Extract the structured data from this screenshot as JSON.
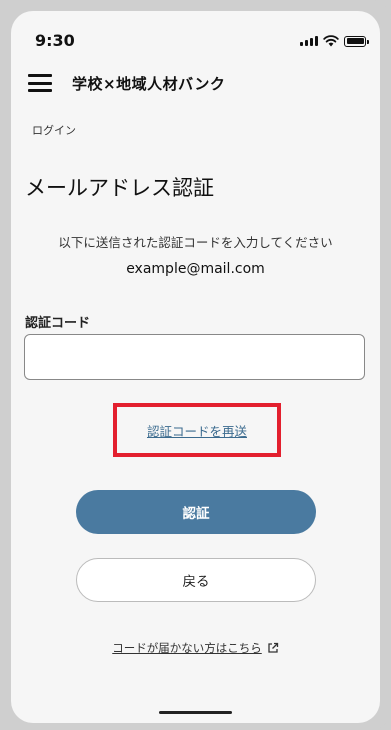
{
  "status_bar": {
    "time": "9:30"
  },
  "header": {
    "menu_icon": "hamburger-menu-icon",
    "title": "学校×地域人材バンク"
  },
  "breadcrumb": "ログイン",
  "page_title": "メールアドレス認証",
  "instruction": "以下に送信された認証コードを入力してください",
  "email": "example@mail.com",
  "form": {
    "code_label": "認証コード",
    "code_value": "",
    "code_placeholder": ""
  },
  "resend_link": "認証コードを再送",
  "buttons": {
    "verify": "認証",
    "back": "戻る"
  },
  "help_link": {
    "label": "コードが届かない方はこちら",
    "icon": "external-link-icon"
  },
  "colors": {
    "primary": "#4a7aa0",
    "link": "#3a6a8e",
    "highlight": "#e31f2e",
    "background": "#f6f6f6"
  }
}
